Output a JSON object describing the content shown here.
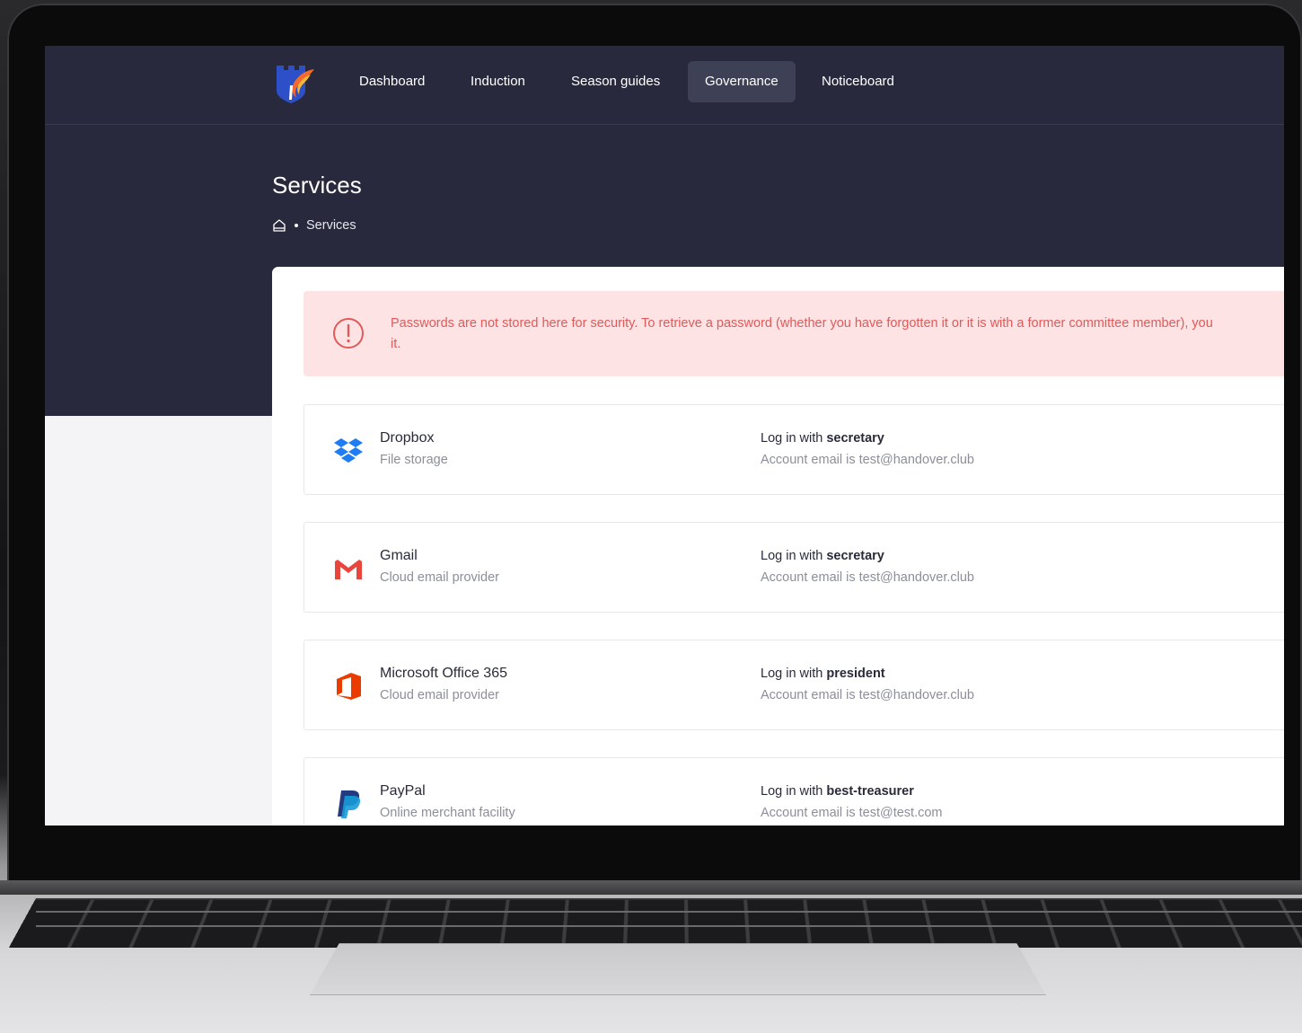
{
  "nav": {
    "items": [
      {
        "label": "Dashboard",
        "active": false
      },
      {
        "label": "Induction",
        "active": false
      },
      {
        "label": "Season guides",
        "active": false
      },
      {
        "label": "Governance",
        "active": true
      },
      {
        "label": "Noticeboard",
        "active": false
      }
    ]
  },
  "page": {
    "title": "Services",
    "breadcrumb": {
      "home_icon": "home-icon",
      "current": "Services"
    }
  },
  "alert": {
    "icon": "alert-circle-icon",
    "text_line1": "Passwords are not stored here for security. To retrieve a password (whether you have forgotten it or it is with a former committee member), you",
    "text_line2": "it."
  },
  "services": [
    {
      "name": "Dropbox",
      "description": "File storage",
      "login_prefix": "Log in with",
      "login_user": "secretary",
      "email_prefix": "Account email is",
      "email": "test@handover.club",
      "icon": "dropbox-icon"
    },
    {
      "name": "Gmail",
      "description": "Cloud email provider",
      "login_prefix": "Log in with",
      "login_user": "secretary",
      "email_prefix": "Account email is",
      "email": "test@handover.club",
      "icon": "gmail-icon"
    },
    {
      "name": "Microsoft Office 365",
      "description": "Cloud email provider",
      "login_prefix": "Log in with",
      "login_user": "president",
      "email_prefix": "Account email is",
      "email": "test@handover.club",
      "icon": "office-icon"
    },
    {
      "name": "PayPal",
      "description": "Online merchant facility",
      "login_prefix": "Log in with",
      "login_user": "best-treasurer",
      "email_prefix": "Account email is",
      "email": "test@test.com",
      "icon": "paypal-icon"
    }
  ],
  "colors": {
    "hero_bg": "#28293d",
    "nav_active_bg": "#3e4055",
    "alert_bg": "#fde3e4",
    "alert_text": "#e05a5a",
    "dropbox_blue": "#1f7cf2",
    "gmail_red": "#e8453c",
    "office_orange": "#eb3c00",
    "paypal_navy": "#253b80"
  }
}
